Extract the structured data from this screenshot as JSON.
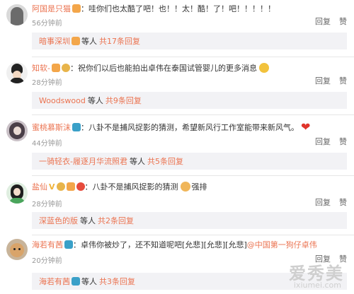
{
  "comments": [
    {
      "user": "阿国是只猫",
      "text": "：哇你们也太酷了吧！也！！太！酷！了！吧！！！！！",
      "time": "56分钟前",
      "reply_label": "回复",
      "like_label": "赞",
      "thread_user": "暗事深圳",
      "thread_mid": "等人",
      "thread_count": "共17条回复"
    },
    {
      "user": "知软-",
      "text": "：祝你们以后也能拍出卓伟在泰国试管婴儿的更多消息",
      "time": "28分钟前",
      "reply_label": "回复",
      "like_label": "赞",
      "thread_user": "Woodswood",
      "thread_mid": "等人",
      "thread_count": "共9条回复"
    },
    {
      "user": "蜜桃慕斯沫",
      "text": "：八卦不是捕风捉影的猜测，希望新风行工作室能带来新风气。",
      "time": "44分钟前",
      "reply_label": "回复",
      "like_label": "赞",
      "thread_user": "一骑轻衣-履逐月华流照君",
      "thread_mid": "等人",
      "thread_count": "共5条回复"
    },
    {
      "user": "盐仙",
      "text": "：八卦不是捕风捉影的猜测",
      "extra": "强排",
      "time": "28分钟前",
      "reply_label": "回复",
      "like_label": "赞",
      "thread_user": "深蓝色的版",
      "thread_mid": "等人",
      "thread_count": "共2条回复"
    },
    {
      "user": "海若有茜",
      "text": "：卓伟你被炒了，还不知道呢吧[允悲][允悲][允悲]",
      "mention": "@中国第一狗仔卓伟",
      "time": "20分钟前",
      "reply_label": "回复",
      "like_label": "赞",
      "thread_user": "海若有茜",
      "thread_mid": "等人",
      "thread_count": "共3条回复"
    }
  ],
  "watermark": {
    "text": "爱秀美",
    "sub": "ixiumei.com"
  }
}
